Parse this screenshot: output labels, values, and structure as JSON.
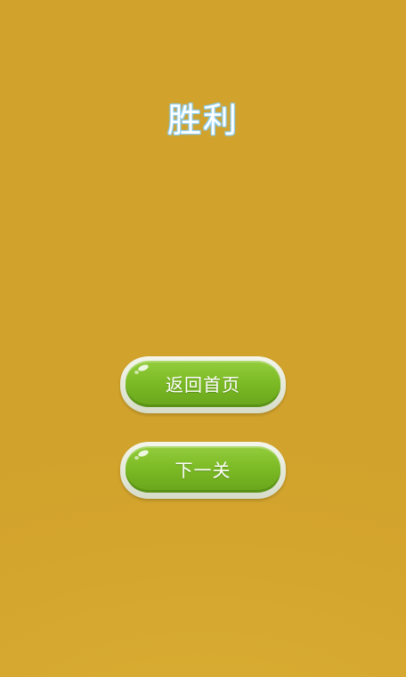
{
  "screen": {
    "title": "胜利",
    "background_color": "#d3a42d",
    "title_outline_color": "#8fd3ff"
  },
  "buttons": {
    "home_label": "返回首页",
    "next_label": "下一关",
    "button_color": "#7dbb26"
  }
}
